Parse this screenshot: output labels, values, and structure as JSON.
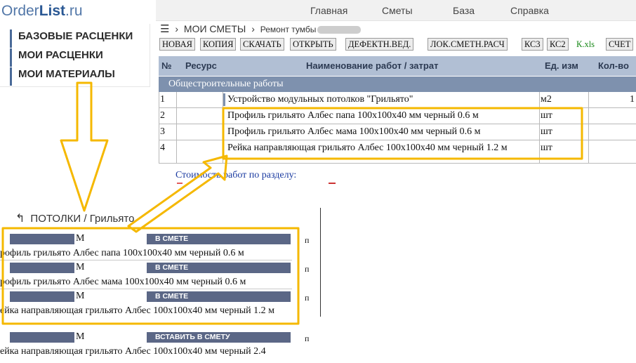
{
  "logo": {
    "part1": "Order",
    "part2": "List",
    "part3": ".ru"
  },
  "topnav": {
    "home": "Главная",
    "estimates": "Сметы",
    "base": "База",
    "help": "Справка"
  },
  "leftmenu": {
    "items": [
      "БАЗОВЫЕ РАСЦЕНКИ",
      "МОИ РАСЦЕНКИ",
      "МОИ МАТЕРИАЛЫ"
    ]
  },
  "breadcrumb": {
    "menu_icon": "hamburger-icon",
    "sep1": "›",
    "link": "МОИ СМЕТЫ",
    "sep2": "›",
    "current": "Ремонт тумбы"
  },
  "toolbar": {
    "buttons": [
      "НОВАЯ",
      "КОПИЯ",
      "СКАЧАТЬ",
      "ОТКРЫТЬ",
      "ДЕФЕКТН.ВЕД.",
      "ЛОК.СМЕТН.РАСЧ",
      "КС3",
      "КС2",
      "К.xls",
      "СЧЕТ"
    ]
  },
  "table": {
    "headers": [
      "№",
      "Ресурс",
      "Наименование работ / затрат",
      "Ед. изм",
      "Кол-во"
    ],
    "section": "Общестроительные работы",
    "rows": [
      {
        "n": "1",
        "res": "",
        "name": "Устройство модульных потолков \"Грильято\"",
        "unit": "м2",
        "qty": "1"
      },
      {
        "n": "2",
        "res": "",
        "name": "Профиль грильято Албес папа 100x100x40 мм черный 0.6 м",
        "unit": "шт",
        "qty": ""
      },
      {
        "n": "3",
        "res": "",
        "name": "Профиль грильято Албес мама 100x100x40 мм черный 0.6 м",
        "unit": "шт",
        "qty": ""
      },
      {
        "n": "4",
        "res": "",
        "name": "Рейка направляющая грильято Албес 100x100x40 мм черный 1.2 м",
        "unit": "шт",
        "qty": ""
      }
    ],
    "section_total": "Стоимость работ по разделу:"
  },
  "materials": {
    "back_icon": "back-arrow-icon",
    "title": "ПОТОЛКИ / Грильято",
    "items": [
      {
        "unit": "М",
        "badge": "В СМЕТЕ",
        "text": "рофиль грильято Албес папа 100x100x40 мм черный 0.6 м",
        "extra": "п"
      },
      {
        "unit": "М",
        "badge": "В СМЕТЕ",
        "text": "рофиль грильято Албес мама 100x100x40 мм черный 0.6 м",
        "extra": "п"
      },
      {
        "unit": "М",
        "badge": "В СМЕТЕ",
        "text": "ейка направляющая грильято Албес 100x100x40 мм черный 1.2 м",
        "extra": "п"
      },
      {
        "unit": "М",
        "badge": "ВСТАВИТЬ В СМЕТУ",
        "text": "ейка направляющая грильято Албес 100x100x40 мм черный 2.4",
        "extra": "п"
      }
    ]
  },
  "colors": {
    "annotation": "#f5b800",
    "header_bg": "#b1bfd4",
    "section_bg": "#7e91ae",
    "badge_bg": "#5b6786"
  }
}
